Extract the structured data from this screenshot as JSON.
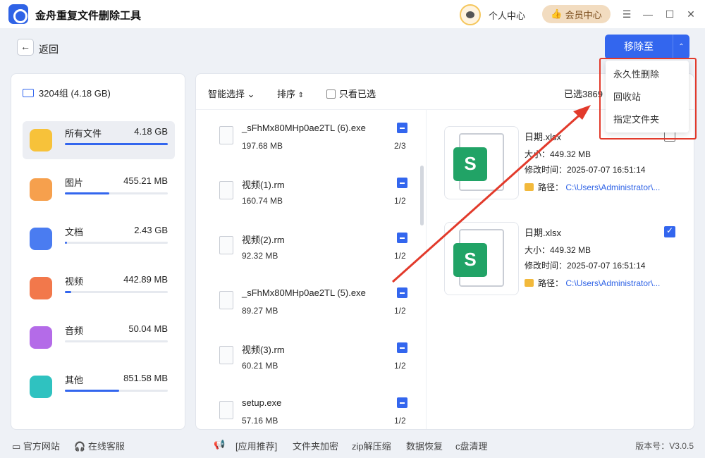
{
  "app": {
    "title": "金舟重复文件删除工具"
  },
  "header": {
    "user_center": "个人中心",
    "vip_center": "会员中心"
  },
  "nav": {
    "back": "返回"
  },
  "actions": {
    "move_to": "移除至",
    "menu": [
      "永久性删除",
      "回收站",
      "指定文件夹"
    ]
  },
  "sidebar": {
    "group": "3204组 (4.18 GB)",
    "categories": [
      {
        "name": "所有文件",
        "size": "4.18 GB",
        "fill": 1.0,
        "color": "#f7c23a",
        "icon": "folder-icon"
      },
      {
        "name": "图片",
        "size": "455.21 MB",
        "fill": 0.43,
        "color": "#f6a04d",
        "icon": "image-icon"
      },
      {
        "name": "文档",
        "size": "2.43 GB",
        "fill": 0.02,
        "color": "#4a7cf1",
        "icon": "document-icon"
      },
      {
        "name": "视频",
        "size": "442.89 MB",
        "fill": 0.06,
        "color": "#f2784b",
        "icon": "video-icon"
      },
      {
        "name": "音频",
        "size": "50.04 MB",
        "fill": 0.0,
        "color": "#b46be8",
        "icon": "music-icon"
      },
      {
        "name": "其他",
        "size": "851.58 MB",
        "fill": 0.53,
        "color": "#2fc2c0",
        "icon": "apps-icon"
      }
    ]
  },
  "toolbar": {
    "smart_select": "智能选择",
    "sort": "排序",
    "only_selected": "只看已选",
    "selected_count": "已选3869"
  },
  "files": [
    {
      "name": "_sFhMx80MHp0ae2TL (6).exe",
      "size": "197.68 MB",
      "count": "2/3"
    },
    {
      "name": "视频(1).rm",
      "size": "160.74 MB",
      "count": "1/2"
    },
    {
      "name": "视频(2).rm",
      "size": "92.32 MB",
      "count": "1/2"
    },
    {
      "name": "_sFhMx80MHp0ae2TL (5).exe",
      "size": "89.27 MB",
      "count": "1/2"
    },
    {
      "name": "视频(3).rm",
      "size": "60.21 MB",
      "count": "1/2"
    },
    {
      "name": "setup.exe",
      "size": "57.16 MB",
      "count": "1/2"
    }
  ],
  "details": [
    {
      "name": "日期.xlsx",
      "size": "大小：449.32 MB",
      "modified": "修改时间：2025-07-07 16:51:14",
      "path_label": "路径：",
      "path": "C:\\Users\\Administrator\\...",
      "checked": false
    },
    {
      "name": "日期.xlsx",
      "size": "大小：449.32 MB",
      "modified": "修改时间：2025-07-07 16:51:14",
      "path_label": "路径：",
      "path": "C:\\Users\\Administrator\\...",
      "checked": true
    }
  ],
  "footer": {
    "website": "官方网站",
    "support": "在线客服",
    "recommend": "[应用推荐]",
    "apps": [
      "文件夹加密",
      "zip解压缩",
      "数据恢复",
      "c盘清理"
    ],
    "version": "版本号：V3.0.5"
  },
  "colors": {
    "accent": "#3366ee",
    "annotation": "#e23a2b",
    "excel": "#21a366"
  }
}
